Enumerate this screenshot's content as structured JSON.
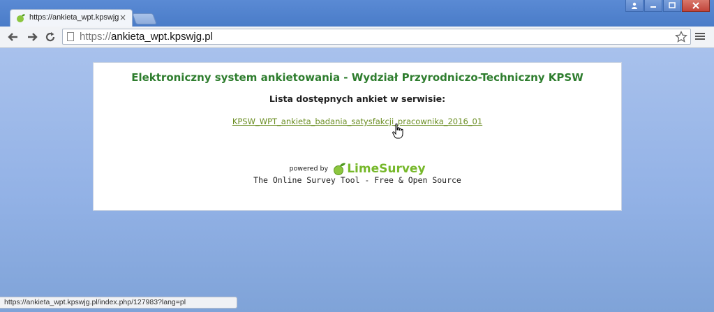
{
  "browser": {
    "tab_title": "https://ankieta_wpt.kpswjg.p",
    "tab_close": "×",
    "url_scheme": "https://",
    "url_host": "ankieta_wpt.kpswjg.pl",
    "status_url": "https://ankieta_wpt.kpswjg.pl/index.php/127983?lang=pl"
  },
  "page": {
    "title": "Elektroniczny system ankietowania - Wydział Przyrodniczo-Techniczny KPSW",
    "list_heading": "Lista dostępnych ankiet w serwisie:",
    "survey_link": "KPSW_WPT_ankieta_badania_satysfakcji_pracownika_2016_01",
    "powered_by": "powered by",
    "logo_text": "LimeSurvey",
    "tagline": "The Online Survey Tool - Free & Open Source"
  },
  "colors": {
    "title_green": "#2e7d2e",
    "link_olive": "#6b8e23",
    "lime": "#76b82a"
  }
}
